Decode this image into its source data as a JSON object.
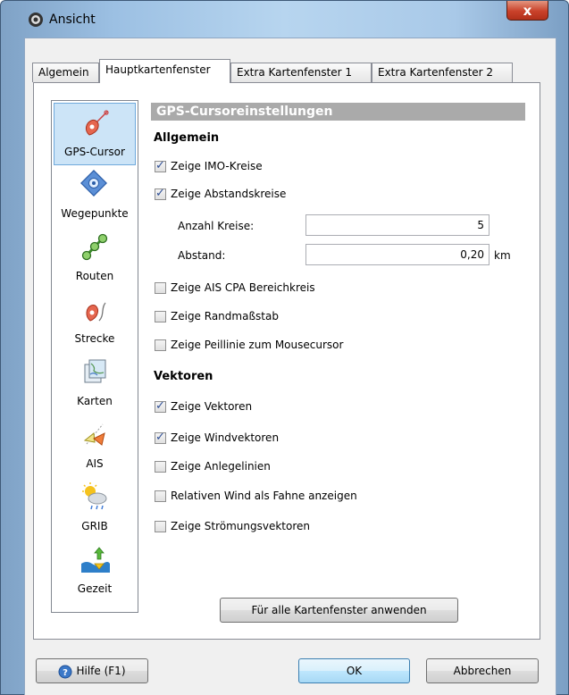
{
  "window": {
    "title": "Ansicht",
    "close_glyph": "x"
  },
  "tabs": [
    {
      "label": "Algemein"
    },
    {
      "label": "Hauptkartenfenster"
    },
    {
      "label": "Extra Kartenfenster 1"
    },
    {
      "label": "Extra Kartenfenster 2"
    }
  ],
  "active_tab": "Hauptkartenfenster",
  "sidebar": {
    "items": [
      {
        "label": "GPS-Cursor",
        "icon": "gps-cursor-icon",
        "active": true
      },
      {
        "label": "Wegepunkte",
        "icon": "waypoint-icon"
      },
      {
        "label": "Routen",
        "icon": "route-icon"
      },
      {
        "label": "Strecke",
        "icon": "track-icon"
      },
      {
        "label": "Karten",
        "icon": "charts-icon"
      },
      {
        "label": "AIS",
        "icon": "ais-icon"
      },
      {
        "label": "GRIB",
        "icon": "grib-weather-icon"
      },
      {
        "label": "Gezeit",
        "icon": "tide-icon"
      }
    ]
  },
  "main": {
    "header": "GPS-Cursoreinstellungen",
    "general": {
      "title": "Allgemein",
      "imo": {
        "label": "Zeige IMO-Kreise",
        "checked": true
      },
      "distance_circles": {
        "label": "Zeige Abstandskreise",
        "checked": true
      },
      "count": {
        "label": "Anzahl Kreise:",
        "value": "5"
      },
      "spacing": {
        "label": "Abstand:",
        "value": "0,20",
        "unit": "km"
      },
      "ais_cpa": {
        "label": "Zeige AIS CPA Bereichkreis",
        "checked": false
      },
      "scale": {
        "label": "Zeige Randmaßstab",
        "checked": false
      },
      "bearing": {
        "label": "Zeige Peillinie zum Mousecursor",
        "checked": false
      }
    },
    "vectors": {
      "title": "Vektoren",
      "show_vectors": {
        "label": "Zeige Vektoren",
        "checked": true
      },
      "wind_vectors": {
        "label": "Zeige Windvektoren",
        "checked": true
      },
      "laylines": {
        "label": "Zeige Anlegelinien",
        "checked": false
      },
      "relative_wind": {
        "label": "Relativen Wind als Fahne anzeigen",
        "checked": false
      },
      "current_vectors": {
        "label": "Zeige Strömungsvektoren",
        "checked": false
      }
    },
    "apply_all_label": "Für alle Kartenfenster anwenden"
  },
  "footer": {
    "help_label": "Hilfe (F1)",
    "ok_label": "OK",
    "cancel_label": "Abbrechen"
  },
  "colors": {
    "section_header": "#aaaaaa",
    "selection": "#cce4f7",
    "check": "#2f4f96"
  }
}
